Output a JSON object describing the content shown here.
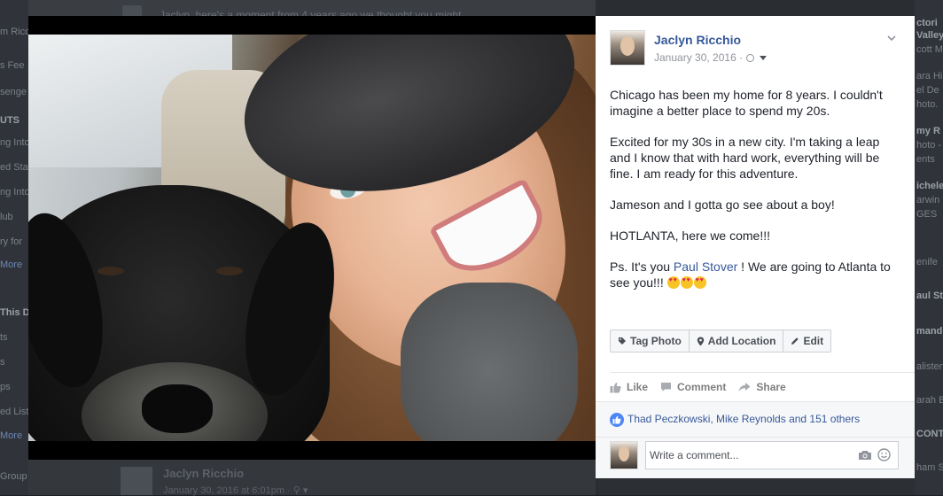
{
  "post": {
    "author": "Jaclyn Ricchio",
    "date": "January 30, 2016 ·",
    "paragraphs": {
      "p1": "Chicago has been my home for 8 years. I couldn't imagine a better place to spend my 20s.",
      "p2": "Excited for my 30s in a new city. I'm taking a leap and I know that with hard work, everything will be fine. I am ready for this adventure.",
      "p3": "Jameson and I gotta go see about a boy!",
      "p4": "HOTLANTA, here we come!!!",
      "p5_before": "Ps. It's you ",
      "p5_mention": "Paul Stover",
      "p5_after": " ! We are going to Atlanta to see you!!! "
    },
    "emoji": "heart-eyes-emoji",
    "tag_actions": {
      "tag_photo": "Tag Photo",
      "add_location": "Add Location",
      "edit": "Edit"
    },
    "actions": {
      "like": "Like",
      "comment": "Comment",
      "share": "Share"
    },
    "reactions_text": "Thad Peczkowski, Mike Reynolds and 151 others",
    "comment_placeholder": "Write a comment..."
  },
  "background": {
    "top_text": "Jaclyn, here's a moment from 4 years ago we thought you might",
    "bottom_name": "Jaclyn Ricchio",
    "bottom_meta": "January 30, 2016 at 6:01pm · ⚲ ▾",
    "left_items": [
      "m Ricc",
      "s Fee",
      "senge",
      "UTS",
      "ng Into",
      "ed Sta",
      "ng Into",
      "lub",
      "ry for",
      "More",
      "This D",
      "ts",
      "s",
      "ps",
      "ed List",
      "More"
    ],
    "left_bottom": "Group · Event",
    "right_items": [
      "ctori",
      "Valley",
      "cott M",
      "ara Hi",
      "el De",
      "hoto.",
      "my R",
      "hoto -",
      "ents",
      "ichele",
      "arwin",
      "GES",
      "enife",
      "aul St",
      "mand",
      "alisten",
      "arah B",
      "CONTAC",
      "ham S"
    ]
  },
  "colors": {
    "link": "#365899",
    "text": "#1d2129",
    "muted": "#90949c",
    "like_blue": "#4e86f7"
  }
}
